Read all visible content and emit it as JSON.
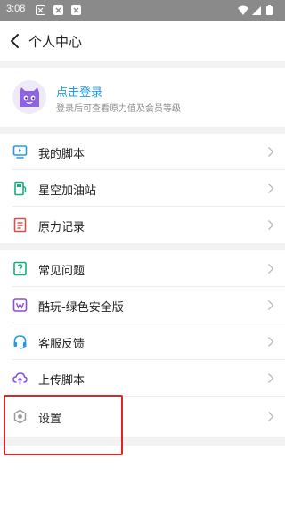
{
  "status_bar": {
    "time": "3:08",
    "icons": [
      "notification-icon",
      "app-icon",
      "app-icon",
      "wifi-icon",
      "signal-icon",
      "battery-icon"
    ]
  },
  "header": {
    "title": "个人中心",
    "back_icon": "chevron-left-icon"
  },
  "profile": {
    "login_text": "点击登录",
    "description": "登录后可查看原力值及会员等级",
    "avatar_icon": "mascot-avatar-icon"
  },
  "menu_group_1": [
    {
      "label": "我的脚本",
      "icon": "script-screen-icon",
      "color": "#1e9be8"
    },
    {
      "label": "星空加油站",
      "icon": "fuel-station-icon",
      "color": "#14b07a"
    },
    {
      "label": "原力记录",
      "icon": "record-document-icon",
      "color": "#e24a4a"
    }
  ],
  "menu_group_2": [
    {
      "label": "常见问题",
      "icon": "faq-question-icon",
      "color": "#14b07a"
    },
    {
      "label": "酷玩-绿色安全版",
      "icon": "kuwan-app-icon",
      "color": "#8a4fd6"
    },
    {
      "label": "客服反馈",
      "icon": "headset-support-icon",
      "color": "#1e9be8"
    },
    {
      "label": "上传脚本",
      "icon": "cloud-upload-icon",
      "color": "#8a4fd6"
    },
    {
      "label": "设置",
      "icon": "settings-hexagon-icon",
      "color": "#9a9a9a"
    }
  ],
  "colors": {
    "accent": "#1e9be8",
    "background_gap": "#f2f2f2",
    "highlight_border": "#e02424"
  }
}
